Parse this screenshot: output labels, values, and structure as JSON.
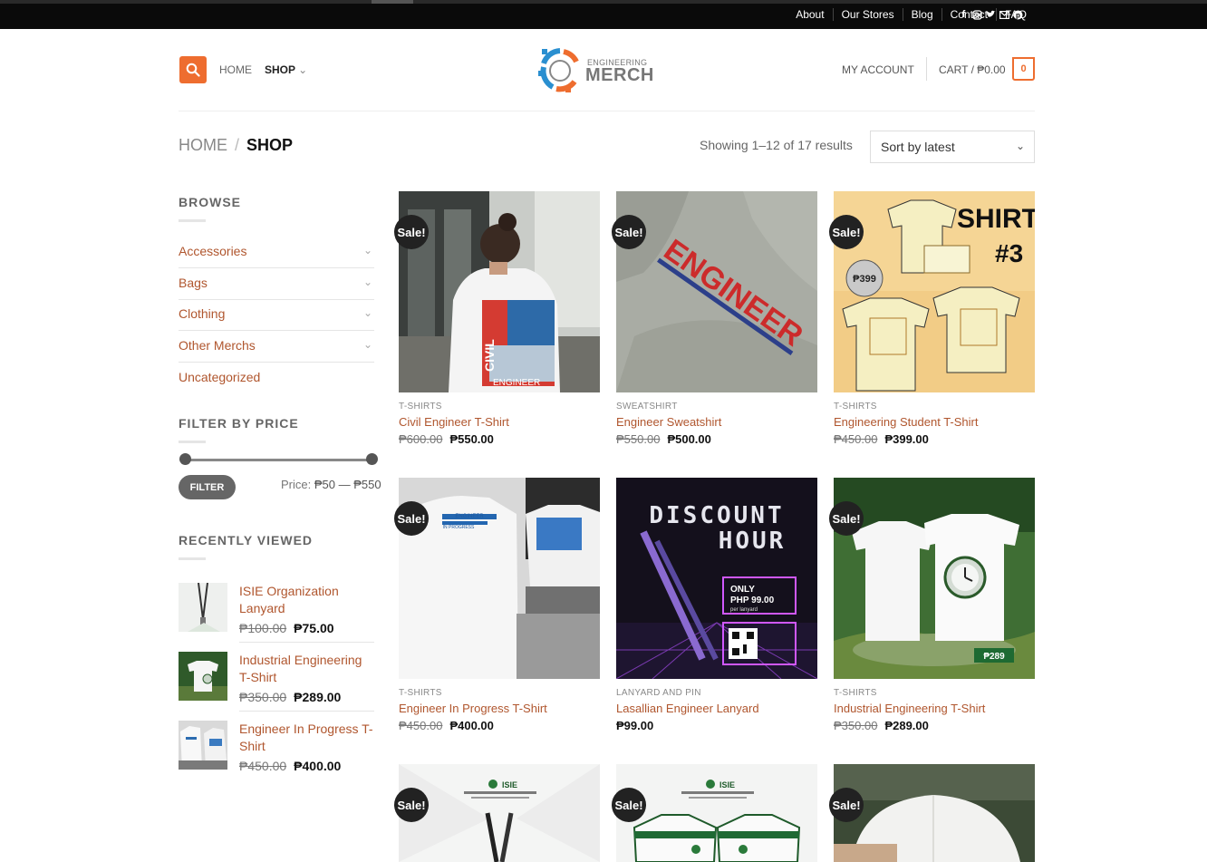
{
  "topbar": {
    "links": [
      "About",
      "Our Stores",
      "Blog",
      "Contact",
      "FAQ"
    ],
    "social_icons": [
      "facebook-icon",
      "instagram-icon",
      "twitter-icon",
      "email-icon",
      "pinterest-icon"
    ]
  },
  "header": {
    "nav": {
      "home": "HOME",
      "shop": "SHOP"
    },
    "logo": {
      "line1": "ENGINEERING",
      "line2": "MERCH"
    },
    "account": "MY ACCOUNT",
    "cart": "CART / ₱0.00",
    "cart_count": "0"
  },
  "breadcrumb": {
    "home": "HOME",
    "sep": "/",
    "current": "SHOP"
  },
  "results": {
    "showing": "Showing 1–12 of 17 results",
    "sort_selected": "Sort by latest"
  },
  "sidebar": {
    "browse_title": "BROWSE",
    "categories": [
      "Accessories",
      "Bags",
      "Clothing",
      "Other Merchs",
      "Uncategorized"
    ],
    "filter_title": "FILTER BY PRICE",
    "filter_button": "FILTER",
    "price_label": "Price:",
    "price_range": "₱50 — ₱550",
    "recent_title": "RECENTLY VIEWED",
    "recent": [
      {
        "name": "ISIE Organization Lanyard",
        "old_price": "₱100.00",
        "new_price": "₱75.00"
      },
      {
        "name": "Industrial Engineering T-Shirt",
        "old_price": "₱350.00",
        "new_price": "₱289.00"
      },
      {
        "name": "Engineer In Progress T-Shirt",
        "old_price": "₱450.00",
        "new_price": "₱400.00"
      }
    ]
  },
  "products": [
    {
      "sale": "Sale!",
      "category": "T-SHIRTS",
      "title": "Civil Engineer T-Shirt",
      "old_price": "₱600.00",
      "new_price": "₱550.00"
    },
    {
      "sale": "Sale!",
      "category": "SWEATSHIRT",
      "title": "Engineer Sweatshirt",
      "old_price": "₱550.00",
      "new_price": "₱500.00"
    },
    {
      "sale": "Sale!",
      "category": "T-SHIRTS",
      "title": "Engineering Student T-Shirt",
      "old_price": "₱450.00",
      "new_price": "₱399.00"
    },
    {
      "sale": "Sale!",
      "category": "T-SHIRTS",
      "title": "Engineer In Progress T-Shirt",
      "old_price": "₱450.00",
      "new_price": "₱400.00"
    },
    {
      "sale": "",
      "category": "LANYARD AND PIN",
      "title": "Lasallian Engineer Lanyard",
      "old_price": "",
      "new_price": "₱99.00"
    },
    {
      "sale": "Sale!",
      "category": "T-SHIRTS",
      "title": "Industrial Engineering T-Shirt",
      "old_price": "₱350.00",
      "new_price": "₱289.00"
    },
    {
      "sale": "Sale!"
    },
    {
      "sale": "Sale!"
    },
    {
      "sale": "Sale!"
    }
  ],
  "image_text": {
    "civil": "CIVIL",
    "engineer": "ENGINEER",
    "shirt3_a": "SHIRT",
    "shirt3_b": "#3",
    "price_tag_399": "₱399",
    "eip_line1": "ENGINEER",
    "eip_line2": "IN PROGRESS",
    "discount_line1": "DISCOUNT",
    "discount_line2": "HOUR",
    "only": "ONLY",
    "php99": "PHP 99.00",
    "per_lanyard": "per lanyard",
    "price_tag_289": "₱289",
    "isie": "ISIE"
  },
  "colors": {
    "accent": "#ee6d2f",
    "link": "#b0562e",
    "topbar": "#0a0a0a"
  }
}
